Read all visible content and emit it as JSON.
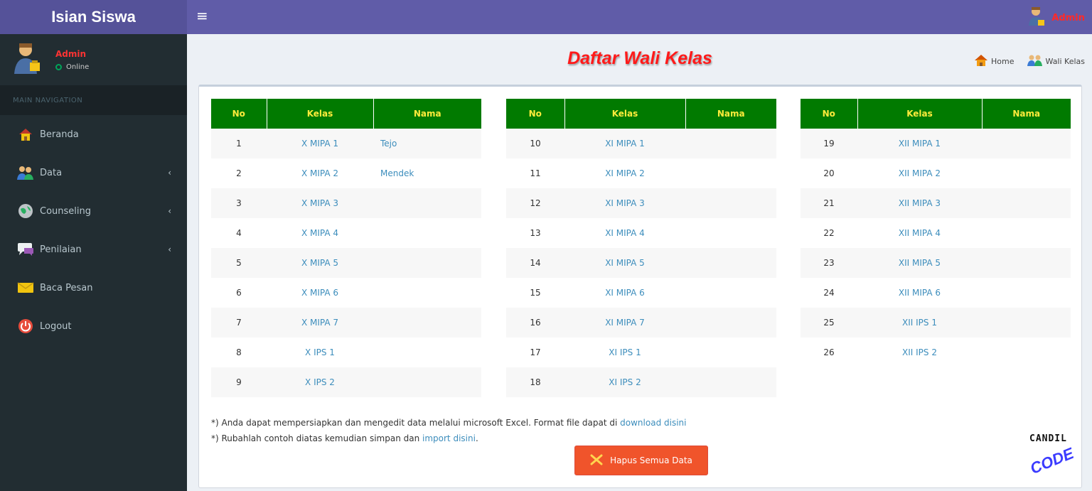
{
  "app": {
    "title": "Isian Siswa"
  },
  "topbar": {
    "user_name": "Admin"
  },
  "sidebar": {
    "user_name": "Admin",
    "user_status": "Online",
    "nav_header": "MAIN NAVIGATION",
    "items": [
      {
        "label": "Beranda",
        "icon": "home-icon",
        "has_chevron": false
      },
      {
        "label": "Data",
        "icon": "users-icon",
        "has_chevron": true
      },
      {
        "label": "Counseling",
        "icon": "globe-icon",
        "has_chevron": true
      },
      {
        "label": "Penilaian",
        "icon": "chat-icon",
        "has_chevron": true
      },
      {
        "label": "Baca Pesan",
        "icon": "mail-icon",
        "has_chevron": false
      },
      {
        "label": "Logout",
        "icon": "power-icon",
        "has_chevron": false
      }
    ]
  },
  "page": {
    "title": "Daftar Wali Kelas"
  },
  "breadcrumb": {
    "home": "Home",
    "current": "Wali Kelas"
  },
  "table": {
    "headers": [
      "No",
      "Kelas",
      "Nama"
    ],
    "groups": [
      [
        {
          "no": "1",
          "kelas": "X MIPA 1",
          "nama": "Tejo"
        },
        {
          "no": "2",
          "kelas": "X MIPA 2",
          "nama": "Mendek"
        },
        {
          "no": "3",
          "kelas": "X MIPA 3",
          "nama": ""
        },
        {
          "no": "4",
          "kelas": "X MIPA 4",
          "nama": ""
        },
        {
          "no": "5",
          "kelas": "X MIPA 5",
          "nama": ""
        },
        {
          "no": "6",
          "kelas": "X MIPA 6",
          "nama": ""
        },
        {
          "no": "7",
          "kelas": "X MIPA 7",
          "nama": ""
        },
        {
          "no": "8",
          "kelas": "X IPS 1",
          "nama": ""
        },
        {
          "no": "9",
          "kelas": "X IPS 2",
          "nama": ""
        }
      ],
      [
        {
          "no": "10",
          "kelas": "XI MIPA 1",
          "nama": ""
        },
        {
          "no": "11",
          "kelas": "XI MIPA 2",
          "nama": ""
        },
        {
          "no": "12",
          "kelas": "XI MIPA 3",
          "nama": ""
        },
        {
          "no": "13",
          "kelas": "XI MIPA 4",
          "nama": ""
        },
        {
          "no": "14",
          "kelas": "XI MIPA 5",
          "nama": ""
        },
        {
          "no": "15",
          "kelas": "XI MIPA 6",
          "nama": ""
        },
        {
          "no": "16",
          "kelas": "XI MIPA 7",
          "nama": ""
        },
        {
          "no": "17",
          "kelas": "XI IPS 1",
          "nama": ""
        },
        {
          "no": "18",
          "kelas": "XI IPS 2",
          "nama": ""
        }
      ],
      [
        {
          "no": "19",
          "kelas": "XII MIPA 1",
          "nama": ""
        },
        {
          "no": "20",
          "kelas": "XII MIPA 2",
          "nama": ""
        },
        {
          "no": "21",
          "kelas": "XII MIPA 3",
          "nama": ""
        },
        {
          "no": "22",
          "kelas": "XII MIPA 4",
          "nama": ""
        },
        {
          "no": "23",
          "kelas": "XII MIPA 5",
          "nama": ""
        },
        {
          "no": "24",
          "kelas": "XII MIPA 6",
          "nama": ""
        },
        {
          "no": "25",
          "kelas": "XII IPS 1",
          "nama": ""
        },
        {
          "no": "26",
          "kelas": "XII IPS 2",
          "nama": ""
        }
      ]
    ]
  },
  "notes": {
    "line1_text": "*) Anda dapat mempersiapkan dan mengedit data melalui microsoft Excel. Format file dapat di ",
    "line1_link": "download disini",
    "line2_text": "*) Rubahlah contoh diatas kemudian simpan dan ",
    "line2_link": "import disini",
    "line2_end": "."
  },
  "actions": {
    "delete_all_label": "Hapus Semua Data"
  },
  "watermark": {
    "line1": "CANDIL",
    "line2": "CODE"
  },
  "colors": {
    "topbar": "#605ca8",
    "brand": "#555299",
    "sidebar": "#222d32",
    "table_header": "#017a00",
    "table_header_text": "#ffeb3b",
    "title": "#ff1a1a",
    "danger_button": "#f0542b",
    "link": "#3c8dbc"
  }
}
